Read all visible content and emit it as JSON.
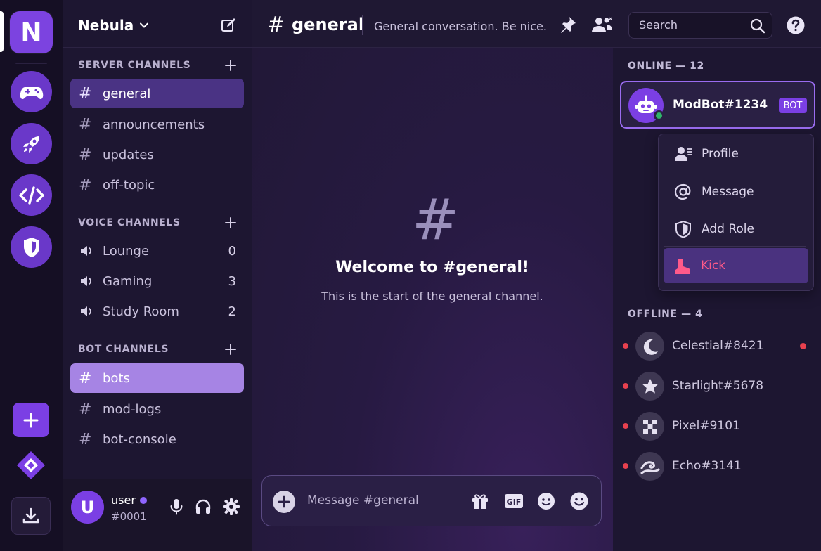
{
  "server": {
    "name": "Nebula",
    "home_letter": "N"
  },
  "rail": {
    "items": [
      "gamepad-icon",
      "rocket-icon",
      "code-icon",
      "shield-icon"
    ]
  },
  "sidebar": {
    "server_channels_label": "SERVER CHANNELS",
    "voice_channels_label": "VOICE CHANNELS",
    "bot_channels_label": "BOT CHANNELS",
    "text_channels": [
      "general",
      "announcements",
      "updates",
      "off-topic"
    ],
    "voice_channels": [
      {
        "name": "Lounge",
        "count": "0"
      },
      {
        "name": "Gaming",
        "count": "3"
      },
      {
        "name": "Study Room",
        "count": "2"
      }
    ],
    "bot_channels": [
      "bots",
      "mod-logs",
      "bot-console"
    ]
  },
  "user": {
    "avatar_letter": "U",
    "name": "user",
    "tag": "#0001"
  },
  "topbar": {
    "channel": "general",
    "topic": "General conversation. Be nice.",
    "search_placeholder": "Search"
  },
  "welcome": {
    "title": "Welcome to #general!",
    "subtitle": "This is the start of the general channel."
  },
  "composer": {
    "placeholder": "Message #general",
    "gif_label": "GIF"
  },
  "members": {
    "online_label": "ONLINE — 12",
    "offline_label": "OFFLINE — 4",
    "bot_name": "ModBot#1234",
    "bot_tag": "BOT",
    "context_menu": [
      "Profile",
      "Message",
      "Add Role",
      "Kick"
    ],
    "offline": [
      "Celestial#8421",
      "Starlight#5678",
      "Pixel#9101",
      "Echo#3141"
    ]
  },
  "colors": {
    "accent": "#7b3fe4",
    "active_channel": "#4a3384",
    "bot_channel_active": "#a684e4",
    "kick": "#ff5a8a",
    "offline_dot": "#e8414f",
    "online_dot": "#2fb56a"
  }
}
